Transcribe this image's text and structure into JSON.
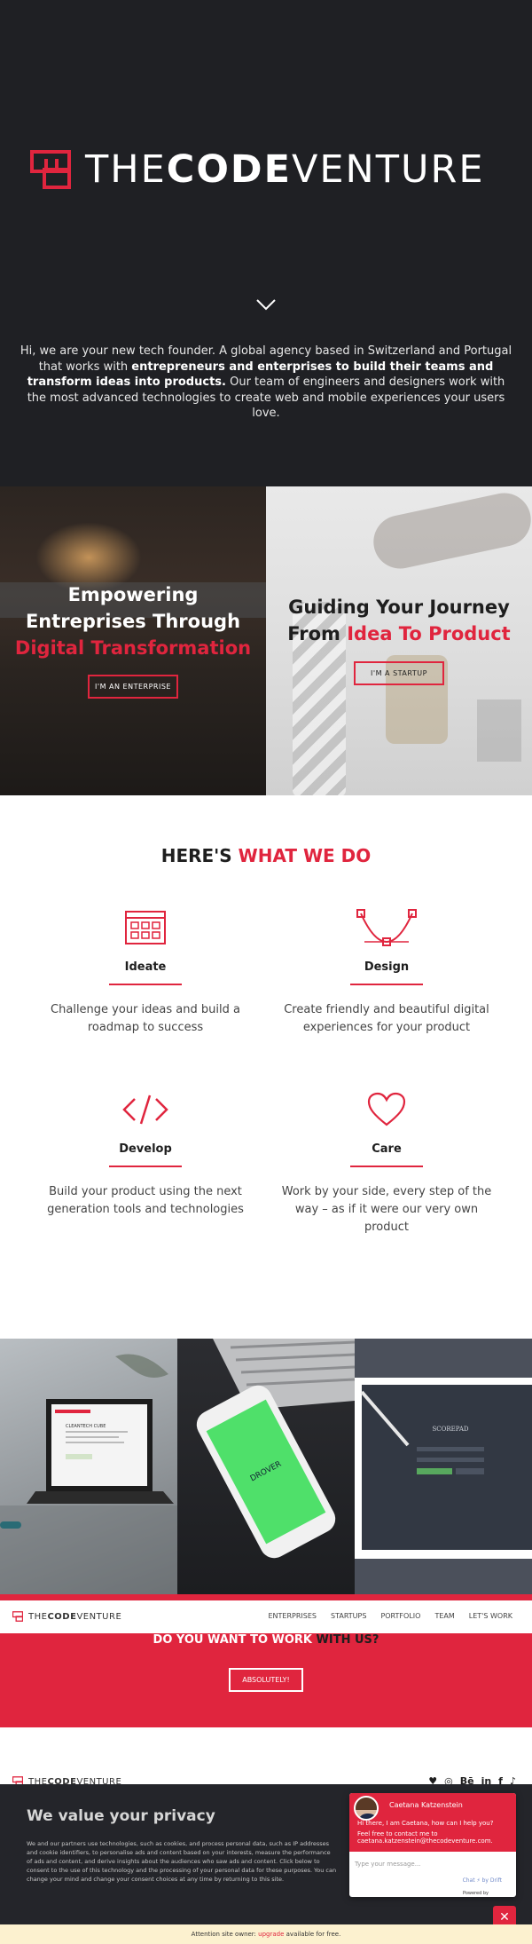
{
  "brand": {
    "logo_prefix": "THE",
    "logo_bold": "CODE",
    "logo_suffix": "VENTURE",
    "accent_color": "#e0253e",
    "dark_color": "#1f2024"
  },
  "hero": {
    "intro_plain_1": "Hi, we are your new tech founder. A global agency based in Switzerland and Portugal that works with ",
    "intro_bold": "entrepreneurs and enterprises to build their teams and transform ideas into products.",
    "intro_plain_2": " Our team of engineers and designers work with the most advanced technologies to create web and mobile experiences your users love.",
    "scroll_icon": "chevron-down-icon"
  },
  "split": {
    "left": {
      "line1": "Empowering",
      "line2": "Entreprises Through",
      "line3": "Digital Transformation",
      "button": "I'M AN ENTERPRISE"
    },
    "right": {
      "line1": "Guiding Your Journey",
      "line2_plain": "From ",
      "line2_red": "Idea To Product",
      "button": "I'M A STARTUP"
    }
  },
  "services": {
    "title_plain": "HERE'S ",
    "title_red": "WHAT WE DO",
    "items": [
      {
        "icon": "browser-window-icon",
        "name": "Ideate",
        "desc": "Challenge your ideas and build a roadmap to success"
      },
      {
        "icon": "bezier-curve-icon",
        "name": "Design",
        "desc": "Create friendly and beautiful digital experiences for your product"
      },
      {
        "icon": "code-icon",
        "name": "Develop",
        "desc": "Build your product using the next generation tools and technologies"
      },
      {
        "icon": "heart-icon",
        "name": "Care",
        "desc": "Work by your side, every step of the way – as if it were our very own product"
      }
    ]
  },
  "portfolio": {
    "tile1_label": "CLEANTECH CUBE",
    "tile2_label": "DROVER",
    "tile3_label": "SCOREPAD"
  },
  "nav": {
    "logo_prefix": "THE",
    "logo_bold": "CODE",
    "logo_suffix": "VENTURE",
    "links": [
      "ENTERPRISES",
      "STARTUPS",
      "PORTFOLIO",
      "TEAM",
      "LET'S WORK"
    ]
  },
  "cta": {
    "title_white": "DO YOU WANT TO WORK ",
    "title_dark": "WITH US?",
    "button": "ABSOLUTELY!"
  },
  "footer": {
    "logo_prefix": "THE",
    "logo_bold": "CODE",
    "logo_suffix": "VENTURE",
    "socials": [
      "vimeo-icon",
      "github-icon",
      "behance-icon",
      "linkedin-icon",
      "facebook-icon",
      "twitter-icon"
    ],
    "social_glyphs": [
      "♥",
      "◎",
      "Bē",
      "in",
      "f",
      "♪"
    ]
  },
  "privacy": {
    "title": "We value your privacy",
    "body": "We and our partners use technologies, such as cookies, and process personal data, such as IP addresses and cookie identifiers, to personalise ads and content based on your interests, measure the performance of ads and content, and derive insights about the audiences who saw ads and content. Click below to consent to the use of this technology and the processing of your personal data for these purposes. You can change your mind and change your consent choices at any time by returning to this site."
  },
  "chat": {
    "agent_name": "Caetana Katzenstein",
    "message1": "Hi there, I am Caetana, how can I help you?",
    "message2": "Feel free to contact me to caetana.katzenstein@thecodeventure.com.",
    "input_placeholder": "Type your message...",
    "drift_credit": "Chat ⚡ by Drift",
    "powered_by": "Powered by",
    "close_glyph": "✕"
  },
  "notice": {
    "before": "Attention site owner: ",
    "link": "upgrade",
    "after": " available for free."
  }
}
